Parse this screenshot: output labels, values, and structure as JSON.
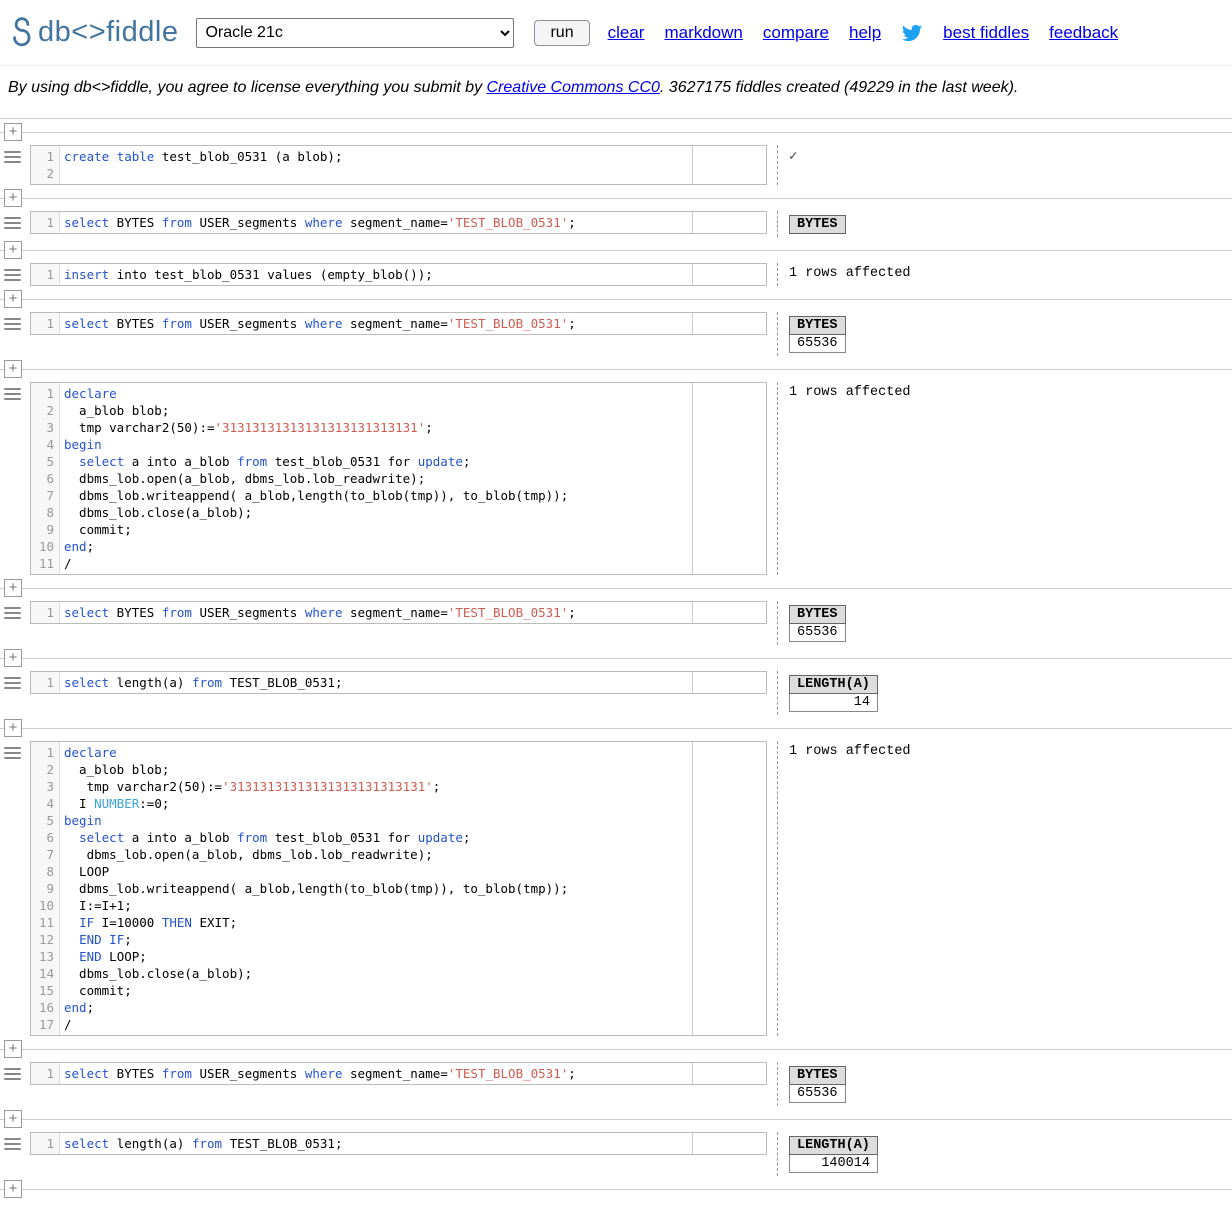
{
  "colors": {
    "logo": "#41749f",
    "link": "#0000ee",
    "twitter": "#1da1f2",
    "kw": "#2453cc",
    "str": "#d05b51",
    "typ": "#3aa3dc"
  },
  "header": {
    "logo_text": "db<>fiddle",
    "database": "Oracle 21c",
    "run_label": "run",
    "links_left": [
      "clear",
      "markdown",
      "compare",
      "help"
    ],
    "links_right": [
      "best fiddles",
      "feedback"
    ]
  },
  "notice": {
    "prefix": "By using db<>fiddle, you agree to license everything you submit by ",
    "link": "Creative Commons CC0",
    "suffix": ". 3627175 fiddles created (49229 in the last week)."
  },
  "blocks": [
    {
      "code": [
        [
          [
            "kw",
            "create"
          ],
          [
            "pl",
            " "
          ],
          [
            "kw",
            "table"
          ],
          [
            "pl",
            " test_blob_0531 (a blob);"
          ]
        ],
        []
      ],
      "result": {
        "type": "check",
        "text": "✓"
      }
    },
    {
      "code": [
        [
          [
            "kw",
            "select"
          ],
          [
            "pl",
            " BYTES "
          ],
          [
            "kw",
            "from"
          ],
          [
            "pl",
            " USER_segments "
          ],
          [
            "kw",
            "where"
          ],
          [
            "pl",
            " segment_name="
          ],
          [
            "str",
            "'TEST_BLOB_0531'"
          ],
          [
            "pl",
            ";"
          ]
        ]
      ],
      "result": {
        "type": "table",
        "headers": [
          "BYTES"
        ],
        "rows": []
      }
    },
    {
      "code": [
        [
          [
            "kw",
            "insert"
          ],
          [
            "pl",
            " into test_blob_0531 values (empty_blob());"
          ]
        ]
      ],
      "result": {
        "type": "text",
        "text": "1 rows affected"
      }
    },
    {
      "code": [
        [
          [
            "kw",
            "select"
          ],
          [
            "pl",
            " BYTES "
          ],
          [
            "kw",
            "from"
          ],
          [
            "pl",
            " USER_segments "
          ],
          [
            "kw",
            "where"
          ],
          [
            "pl",
            " segment_name="
          ],
          [
            "str",
            "'TEST_BLOB_0531'"
          ],
          [
            "pl",
            ";"
          ]
        ]
      ],
      "result": {
        "type": "table",
        "headers": [
          "BYTES"
        ],
        "rows": [
          [
            "65536"
          ]
        ]
      }
    },
    {
      "code": [
        [
          [
            "kw",
            "declare"
          ]
        ],
        [
          [
            "pl",
            "  a_blob blob;"
          ]
        ],
        [
          [
            "pl",
            "  tmp varchar2(50):="
          ],
          [
            "str",
            "'31313131313131313131313131'"
          ],
          [
            "pl",
            ";"
          ]
        ],
        [
          [
            "kw",
            "begin"
          ]
        ],
        [
          [
            "pl",
            "  "
          ],
          [
            "kw",
            "select"
          ],
          [
            "pl",
            " a into a_blob "
          ],
          [
            "kw",
            "from"
          ],
          [
            "pl",
            " test_blob_0531 for "
          ],
          [
            "kw",
            "update"
          ],
          [
            "pl",
            ";"
          ]
        ],
        [
          [
            "pl",
            "  dbms_lob.open(a_blob, dbms_lob.lob_readwrite);"
          ]
        ],
        [
          [
            "pl",
            "  dbms_lob.writeappend( a_blob,length(to_blob(tmp)), to_blob(tmp));"
          ]
        ],
        [
          [
            "pl",
            "  dbms_lob.close(a_blob);"
          ]
        ],
        [
          [
            "pl",
            "  commit;"
          ]
        ],
        [
          [
            "kw",
            "end"
          ],
          [
            "pl",
            ";"
          ]
        ],
        [
          [
            "pl",
            "/"
          ]
        ]
      ],
      "result": {
        "type": "text",
        "text": "1 rows affected"
      }
    },
    {
      "code": [
        [
          [
            "kw",
            "select"
          ],
          [
            "pl",
            " BYTES "
          ],
          [
            "kw",
            "from"
          ],
          [
            "pl",
            " USER_segments "
          ],
          [
            "kw",
            "where"
          ],
          [
            "pl",
            " segment_name="
          ],
          [
            "str",
            "'TEST_BLOB_0531'"
          ],
          [
            "pl",
            ";"
          ]
        ]
      ],
      "result": {
        "type": "table",
        "headers": [
          "BYTES"
        ],
        "rows": [
          [
            "65536"
          ]
        ]
      }
    },
    {
      "code": [
        [
          [
            "kw",
            "select"
          ],
          [
            "pl",
            " length(a) "
          ],
          [
            "kw",
            "from"
          ],
          [
            "pl",
            " TEST_BLOB_0531;"
          ]
        ]
      ],
      "result": {
        "type": "table",
        "headers": [
          "LENGTH(A)"
        ],
        "rows": [
          [
            "14"
          ]
        ]
      }
    },
    {
      "code": [
        [
          [
            "kw",
            "declare"
          ]
        ],
        [
          [
            "pl",
            "  a_blob blob;"
          ]
        ],
        [
          [
            "pl",
            "   tmp varchar2(50):="
          ],
          [
            "str",
            "'31313131313131313131313131'"
          ],
          [
            "pl",
            ";"
          ]
        ],
        [
          [
            "pl",
            "  I "
          ],
          [
            "typ",
            "NUMBER"
          ],
          [
            "pl",
            ":=0;"
          ]
        ],
        [
          [
            "kw",
            "begin"
          ]
        ],
        [
          [
            "pl",
            "  "
          ],
          [
            "kw",
            "select"
          ],
          [
            "pl",
            " a into a_blob "
          ],
          [
            "kw",
            "from"
          ],
          [
            "pl",
            " test_blob_0531 for "
          ],
          [
            "kw",
            "update"
          ],
          [
            "pl",
            ";"
          ]
        ],
        [
          [
            "pl",
            "   dbms_lob.open(a_blob, dbms_lob.lob_readwrite);"
          ]
        ],
        [
          [
            "pl",
            "  LOOP"
          ]
        ],
        [
          [
            "pl",
            "  dbms_lob.writeappend( a_blob,length(to_blob(tmp)), to_blob(tmp));"
          ]
        ],
        [
          [
            "pl",
            "  I:=I+1;"
          ]
        ],
        [
          [
            "pl",
            "  "
          ],
          [
            "kw",
            "IF"
          ],
          [
            "pl",
            " I=10000 "
          ],
          [
            "kw",
            "THEN"
          ],
          [
            "pl",
            " EXIT;"
          ]
        ],
        [
          [
            "pl",
            "  "
          ],
          [
            "kw",
            "END"
          ],
          [
            "pl",
            " "
          ],
          [
            "kw",
            "IF"
          ],
          [
            "pl",
            ";"
          ]
        ],
        [
          [
            "pl",
            "  "
          ],
          [
            "kw",
            "END"
          ],
          [
            "pl",
            " LOOP;"
          ]
        ],
        [
          [
            "pl",
            "  dbms_lob.close(a_blob);"
          ]
        ],
        [
          [
            "pl",
            "  commit;"
          ]
        ],
        [
          [
            "kw",
            "end"
          ],
          [
            "pl",
            ";"
          ]
        ],
        [
          [
            "pl",
            "/"
          ]
        ]
      ],
      "result": {
        "type": "text",
        "text": "1 rows affected"
      }
    },
    {
      "code": [
        [
          [
            "kw",
            "select"
          ],
          [
            "pl",
            " BYTES "
          ],
          [
            "kw",
            "from"
          ],
          [
            "pl",
            " USER_segments "
          ],
          [
            "kw",
            "where"
          ],
          [
            "pl",
            " segment_name="
          ],
          [
            "str",
            "'TEST_BLOB_0531'"
          ],
          [
            "pl",
            ";"
          ]
        ]
      ],
      "result": {
        "type": "table",
        "headers": [
          "BYTES"
        ],
        "rows": [
          [
            "65536"
          ]
        ]
      }
    },
    {
      "code": [
        [
          [
            "kw",
            "select"
          ],
          [
            "pl",
            " length(a) "
          ],
          [
            "kw",
            "from"
          ],
          [
            "pl",
            " TEST_BLOB_0531;"
          ]
        ]
      ],
      "result": {
        "type": "table",
        "headers": [
          "LENGTH(A)"
        ],
        "rows": [
          [
            "140014"
          ]
        ]
      }
    }
  ]
}
